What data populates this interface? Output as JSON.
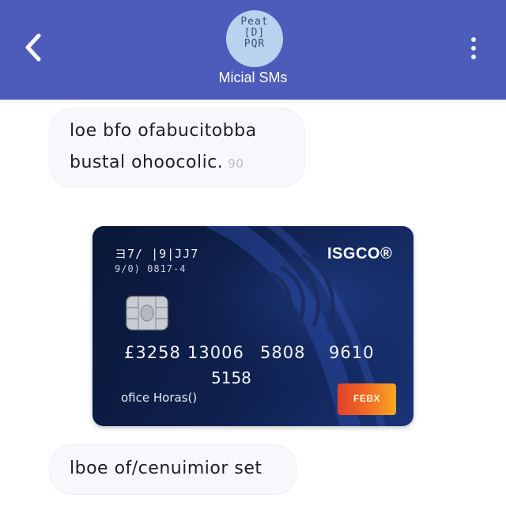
{
  "header": {
    "back_icon": "chevron-left-icon",
    "avatar_text": "Peat\n[D]\nPQR",
    "contact_name": "Micial SMs",
    "menu_icon": "more-vertical-icon",
    "background_color": "#4d5cba"
  },
  "messages": [
    {
      "lines": [
        "loe bfo ofabucitobba",
        "bustal ohoocolic."
      ],
      "time": "90"
    },
    {
      "type": "card-image",
      "card": {
        "brand": "ISGCO®",
        "bank_text": "ヨ7/ |9|̄JJ7",
        "sub_text": "9/0) 0817-4",
        "number_groups": [
          "£3258",
          "13006",
          "5808",
          "9610"
        ],
        "expiry": "5158",
        "holder": "ofice Horas()",
        "network_logo_text": "FEBX",
        "chip_icon": "card-chip-icon"
      }
    },
    {
      "lines": [
        "lboe of/cenuimior set"
      ]
    }
  ]
}
